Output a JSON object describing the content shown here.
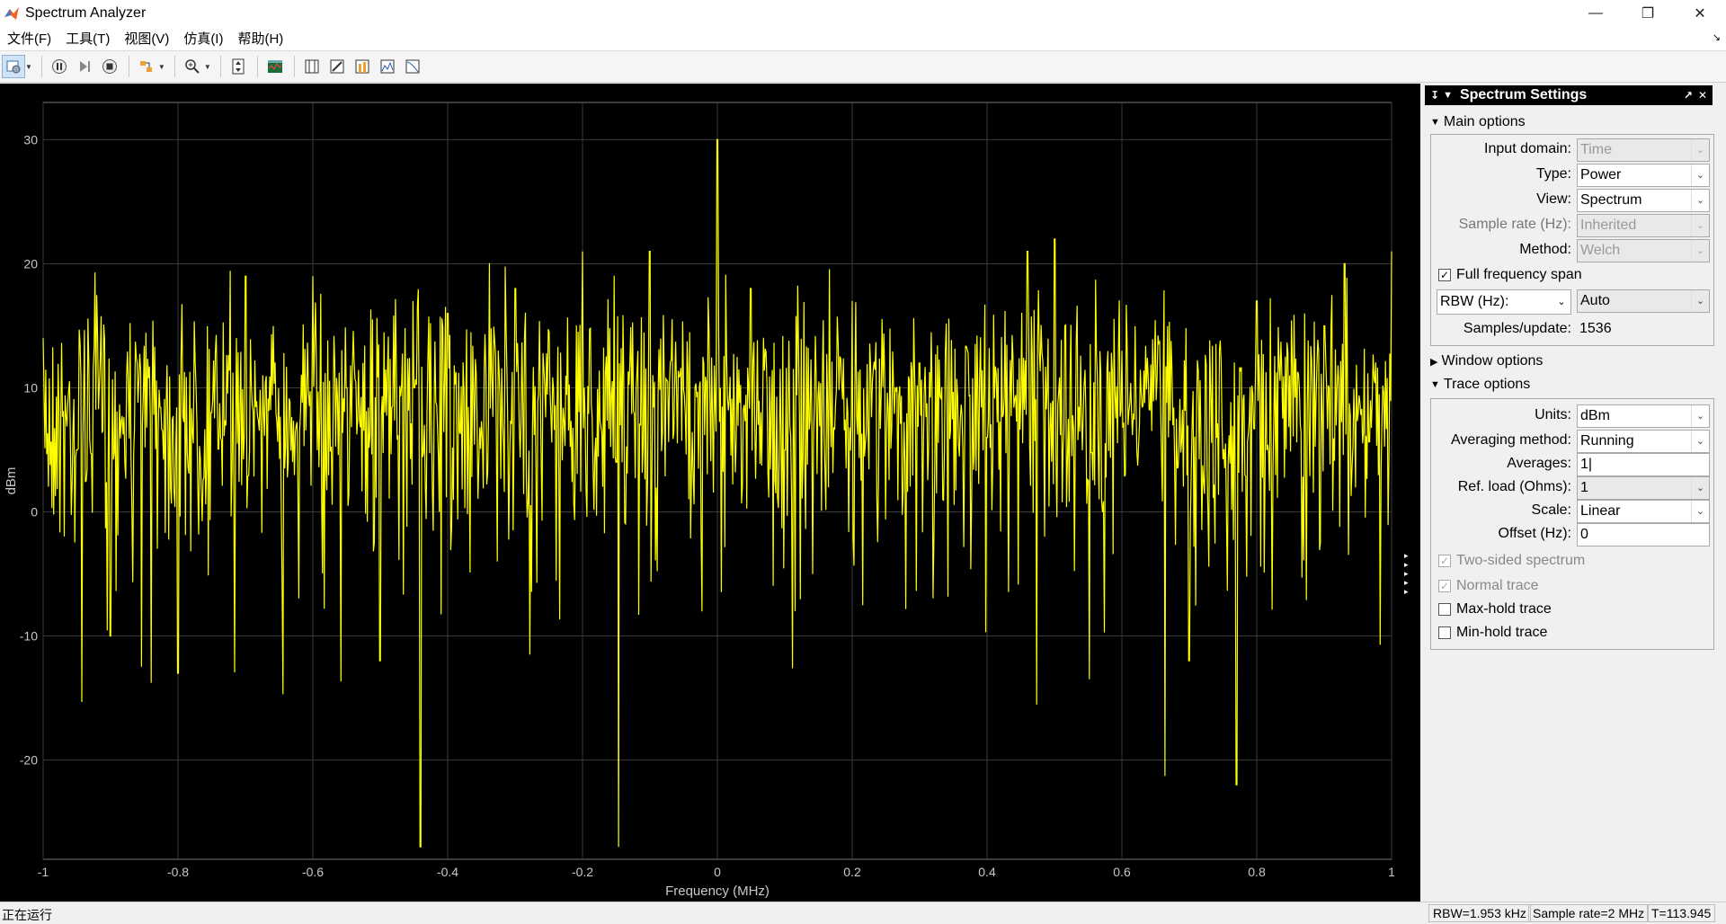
{
  "window": {
    "title": "Spectrum Analyzer"
  },
  "menu": [
    "文件(F)",
    "工具(T)",
    "视图(V)",
    "仿真(I)",
    "帮助(H)"
  ],
  "toolbar": {
    "icons": [
      "settings-icon",
      "pause-icon",
      "step-forward-icon",
      "stop-icon",
      "highlight-simulink-icon",
      "zoom-in-icon",
      "scale-axes-icon",
      "spectrum-settings-icon",
      "cursor-measurements-icon",
      "channel-measurements-icon",
      "distortion-measurements-icon",
      "peak-finder-icon",
      "ccdf-icon"
    ]
  },
  "plot": {
    "ylabel": "dBm",
    "xlabel": "Frequency (MHz)",
    "background": "#000000",
    "trace_color": "#ffff00"
  },
  "chart_data": {
    "type": "line",
    "xlabel": "Frequency (MHz)",
    "ylabel": "dBm",
    "xlim": [
      -1,
      1
    ],
    "ylim": [
      -28,
      33
    ],
    "x_ticks": [
      "-1",
      "-0.8",
      "-0.6",
      "-0.4",
      "-0.2",
      "0",
      "0.2",
      "0.4",
      "0.6",
      "0.8",
      "1"
    ],
    "y_ticks": [
      "30",
      "20",
      "10",
      "0",
      "-10",
      "-20"
    ],
    "grid": true,
    "series": [
      {
        "color": "#ffff00",
        "x": [
          -1.0,
          -0.95,
          -0.9,
          -0.8,
          -0.75,
          -0.7,
          -0.6,
          -0.55,
          -0.5,
          -0.45,
          -0.44,
          -0.4,
          -0.3,
          -0.2,
          -0.15,
          -0.1,
          0.0,
          0.05,
          0.1,
          0.2,
          0.3,
          0.4,
          0.46,
          0.5,
          0.6,
          0.7,
          0.77,
          0.8,
          0.9,
          0.93,
          1.0
        ],
        "y": [
          14,
          5,
          -10,
          -13,
          8,
          19,
          19,
          10,
          -12,
          10,
          -27,
          16,
          18,
          21,
          4,
          21,
          30,
          18,
          5,
          17,
          12,
          6,
          21,
          22,
          13,
          -12,
          -22,
          17,
          15,
          20,
          21
        ]
      }
    ]
  },
  "settings": {
    "header": "Spectrum Settings",
    "main_options": "Main options",
    "input_domain_label": "Input domain:",
    "input_domain_value": "Time",
    "type_label": "Type:",
    "type_value": "Power",
    "view_label": "View:",
    "view_value": "Spectrum",
    "sample_rate_label": "Sample rate (Hz):",
    "sample_rate_value": "Inherited",
    "method_label": "Method:",
    "method_value": "Welch",
    "full_span_label": "Full frequency span",
    "rbw_label": "RBW (Hz):",
    "rbw_value": "Auto",
    "samples_label": "Samples/update:",
    "samples_value": "1536",
    "window_options": "Window options",
    "trace_options": "Trace options",
    "units_label": "Units:",
    "units_value": "dBm",
    "avg_method_label": "Averaging method:",
    "avg_method_value": "Running",
    "averages_label": "Averages:",
    "averages_value": "1",
    "ref_load_label": "Ref. load (Ohms):",
    "ref_load_value": "1",
    "scale_label": "Scale:",
    "scale_value": "Linear",
    "offset_label": "Offset (Hz):",
    "offset_value": "0",
    "two_sided_label": "Two-sided spectrum",
    "normal_trace_label": "Normal trace",
    "max_hold_label": "Max-hold trace",
    "min_hold_label": "Min-hold trace"
  },
  "status": {
    "running": "正在运行",
    "rbw": "RBW=1.953 kHz",
    "sample_rate": "Sample rate=2 MHz",
    "time": "T=113.945"
  }
}
